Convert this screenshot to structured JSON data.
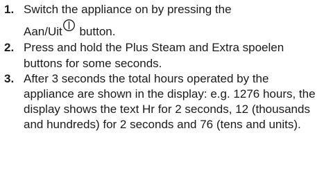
{
  "steps": [
    {
      "number": "1.",
      "line1": "Switch the appliance on by pressing the",
      "line2_before_icon": "Aan/Uit",
      "icon": "power-icon",
      "line2_after_icon": " button."
    },
    {
      "number": "2.",
      "text": "Press and hold the Plus Steam and Extra spoelen buttons for some seconds."
    },
    {
      "number": "3.",
      "text": "After 3 seconds the total hours operated by the appliance are shown in the display: e.g. 1276 hours, the display shows the text Hr for 2 seconds, 12 (thousands and hundreds) for 2 seconds and 76 (tens and units)."
    }
  ]
}
